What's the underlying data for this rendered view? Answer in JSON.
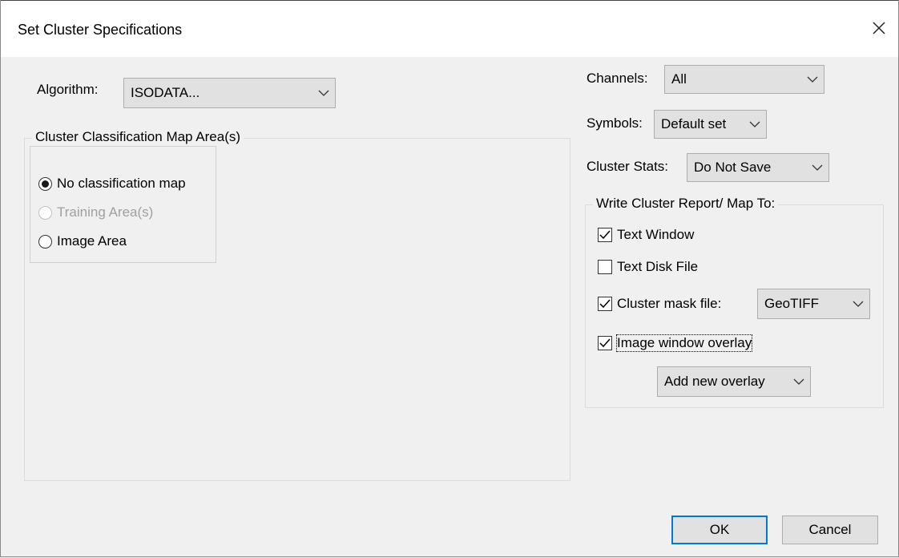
{
  "window": {
    "title": "Set Cluster Specifications",
    "close_glyph": "✕"
  },
  "algorithm": {
    "label": "Algorithm:",
    "value": "ISODATA..."
  },
  "map_area": {
    "legend": "Cluster Classification Map Area(s)",
    "options": [
      {
        "label": "No classification map",
        "selected": true,
        "enabled": true
      },
      {
        "label": "Training Area(s)",
        "selected": false,
        "enabled": false
      },
      {
        "label": "Image Area",
        "selected": false,
        "enabled": true
      }
    ]
  },
  "channels": {
    "label": "Channels:",
    "value": "All"
  },
  "symbols": {
    "label": "Symbols:",
    "value": "Default set"
  },
  "cluster_stats": {
    "label": "Cluster Stats:",
    "value": "Do Not Save"
  },
  "report": {
    "legend": "Write Cluster Report/ Map To:",
    "text_window": {
      "label": "Text Window",
      "checked": true
    },
    "text_disk_file": {
      "label": "Text Disk File",
      "checked": false
    },
    "cluster_mask_file": {
      "label": "Cluster mask file:",
      "checked": true,
      "format": "GeoTIFF"
    },
    "image_window_overlay": {
      "label": "Image window overlay",
      "checked": true
    },
    "overlay_select": "Add new overlay"
  },
  "buttons": {
    "ok": "OK",
    "cancel": "Cancel"
  },
  "colors": {
    "accent": "#0078d7",
    "face": "#e1e1e1",
    "background": "#f0f0f0"
  }
}
